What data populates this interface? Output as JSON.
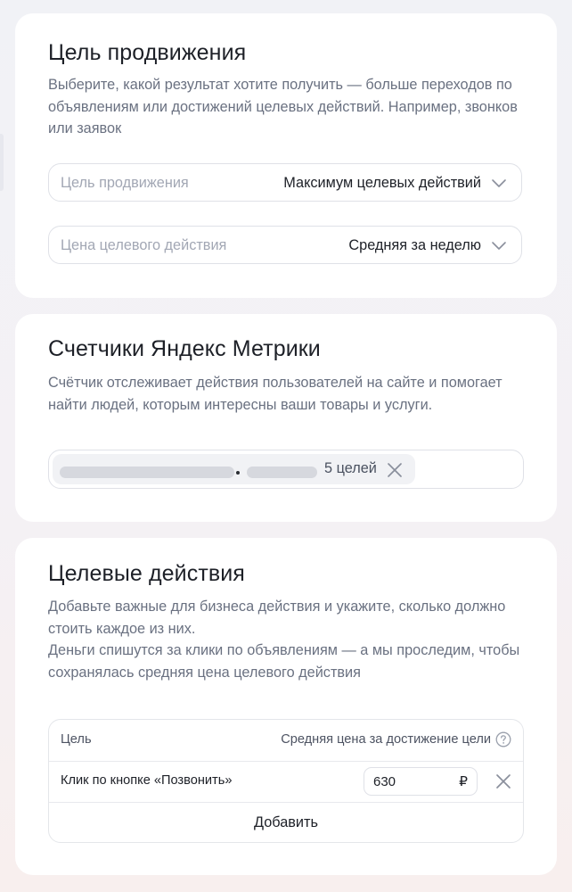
{
  "goal_card": {
    "title": "Цель продвижения",
    "description": "Выберите, какой результат хотите получить — больше переходов по объявлениям или достижений целевых действий. Например, звонков или заявок",
    "goal_select": {
      "label": "Цель продвижения",
      "value": "Максимум целевых действий",
      "icon": "chevron-down-icon"
    },
    "price_select": {
      "label": "Цена целевого действия",
      "value": "Средняя за неделю",
      "icon": "chevron-down-icon"
    }
  },
  "metrika_card": {
    "title": "Счетчики Яндекс Метрики",
    "description": "Счётчик отслеживает действия пользователей на сайте и помогает найти людей, которым интересны ваши товары и услуги.",
    "counter_chip": {
      "goals_count": "5 целей",
      "remove_icon": "close-icon"
    }
  },
  "actions_card": {
    "title": "Целевые действия",
    "description_1": "Добавьте важные для бизнеса действия и укажите, сколько должно стоить каждое из них.",
    "description_2": "Деньги спишутся за клики по объявлениям — а мы проследим, чтобы сохранялась средняя цена целевого действия",
    "table": {
      "col_goal": "Цель",
      "col_price": "Средняя цена за достижение цели",
      "help_icon": "question-circle-icon",
      "rows": [
        {
          "goal": "Клик по кнопке «Позвонить»",
          "price": "630",
          "currency": "₽"
        }
      ],
      "add_label": "Добавить"
    }
  },
  "colors": {
    "page_background": "#f1f2f6",
    "card_background": "#ffffff",
    "title_text": "#1d2027",
    "description_text": "#6a7181",
    "placeholder_text": "#a2a7b4",
    "border": "#dfe1e7"
  }
}
